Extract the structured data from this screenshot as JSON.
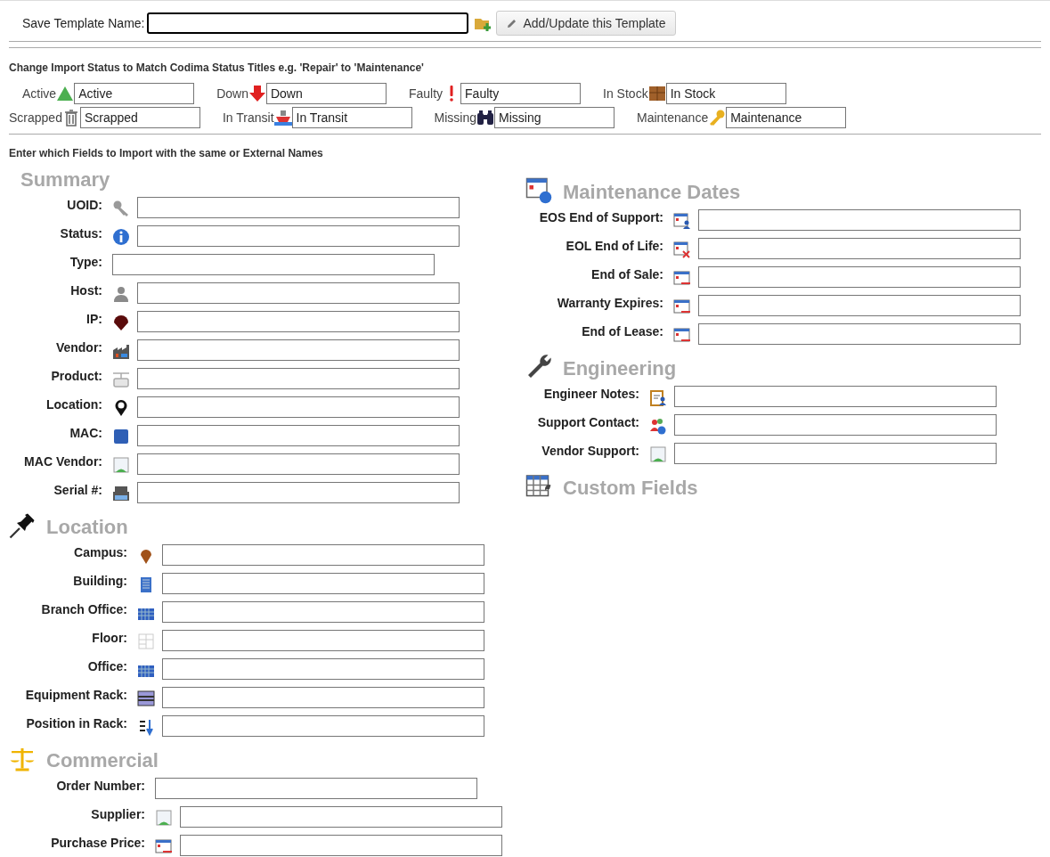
{
  "template": {
    "label": "Save Template Name:",
    "button": "Add/Update this Template"
  },
  "status_heading": "Change Import Status to Match Codima Status Titles e.g. 'Repair' to 'Maintenance'",
  "status_rows": [
    [
      {
        "label": "Active",
        "value": "Active"
      },
      {
        "label": "Down",
        "value": "Down"
      },
      {
        "label": "Faulty",
        "value": "Faulty"
      },
      {
        "label": "In Stock",
        "value": "In Stock"
      }
    ],
    [
      {
        "label": "Scrapped",
        "value": "Scrapped"
      },
      {
        "label": "In Transit",
        "value": "In Transit"
      },
      {
        "label": "Missing",
        "value": "Missing"
      },
      {
        "label": "Maintenance",
        "value": "Maintenance"
      }
    ]
  ],
  "fields_heading": "Enter which Fields to Import with the same or External Names",
  "sections": [
    {
      "title": "Summary",
      "fields": [
        {
          "label": "UOID:"
        },
        {
          "label": "Status:"
        },
        {
          "label": "Type:"
        },
        {
          "label": "Host:"
        },
        {
          "label": "IP:"
        },
        {
          "label": "Vendor:"
        },
        {
          "label": "Product:"
        },
        {
          "label": "Location:"
        },
        {
          "label": "MAC:"
        },
        {
          "label": "MAC Vendor:"
        },
        {
          "label": "Serial #:"
        }
      ]
    },
    {
      "title": "Location",
      "fields": [
        {
          "label": "Campus:"
        },
        {
          "label": "Building:"
        },
        {
          "label": "Branch Office:"
        },
        {
          "label": "Floor:"
        },
        {
          "label": "Office:"
        },
        {
          "label": "Equipment Rack:"
        },
        {
          "label": "Position in Rack:"
        }
      ]
    },
    {
      "title": "Commercial",
      "fields": [
        {
          "label": "Order Number:"
        },
        {
          "label": "Supplier:"
        },
        {
          "label": "Purchase Price:"
        }
      ]
    },
    {
      "title": "Maintenance Dates",
      "fields": [
        {
          "label": "EOS End of Support:"
        },
        {
          "label": "EOL End of Life:"
        },
        {
          "label": "End of Sale:"
        },
        {
          "label": "Warranty Expires:"
        },
        {
          "label": "End of Lease:"
        }
      ]
    },
    {
      "title": "Engineering",
      "fields": [
        {
          "label": "Engineer Notes:"
        },
        {
          "label": "Support Contact:"
        },
        {
          "label": "Vendor Support:"
        }
      ]
    },
    {
      "title": "Custom Fields"
    }
  ]
}
